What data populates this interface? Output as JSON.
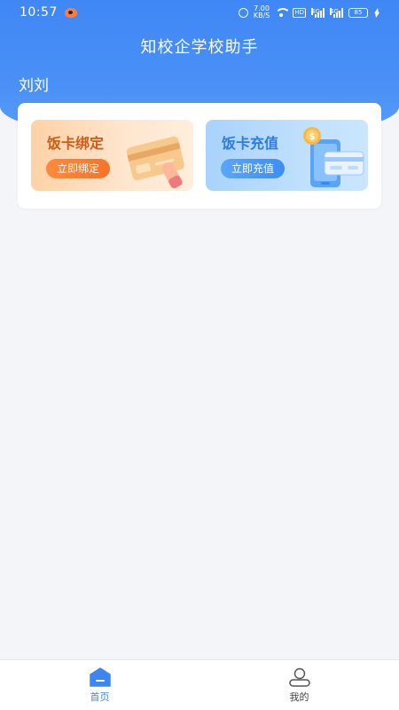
{
  "status_bar": {
    "time": "10:57",
    "net_speed_value": "7.00",
    "net_speed_unit": "KB/S",
    "hd_badge": "HD",
    "signal_1_label": "4G",
    "signal_2_label": "4G",
    "battery_level": "85"
  },
  "header": {
    "title": "知校企学校助手",
    "user_name": "刘刘"
  },
  "cards": {
    "bind": {
      "title": "饭卡绑定",
      "button_label": "立即绑定"
    },
    "recharge": {
      "title": "饭卡充值",
      "button_label": "立即充值"
    }
  },
  "tabbar": {
    "home_label": "首页",
    "mine_label": "我的",
    "active_color": "#3d86f2"
  },
  "colors": {
    "header_blue": "#4a90f6",
    "bind_accent": "#f7732a",
    "recharge_accent": "#3f8df2",
    "page_bg": "#f3f5f9"
  }
}
